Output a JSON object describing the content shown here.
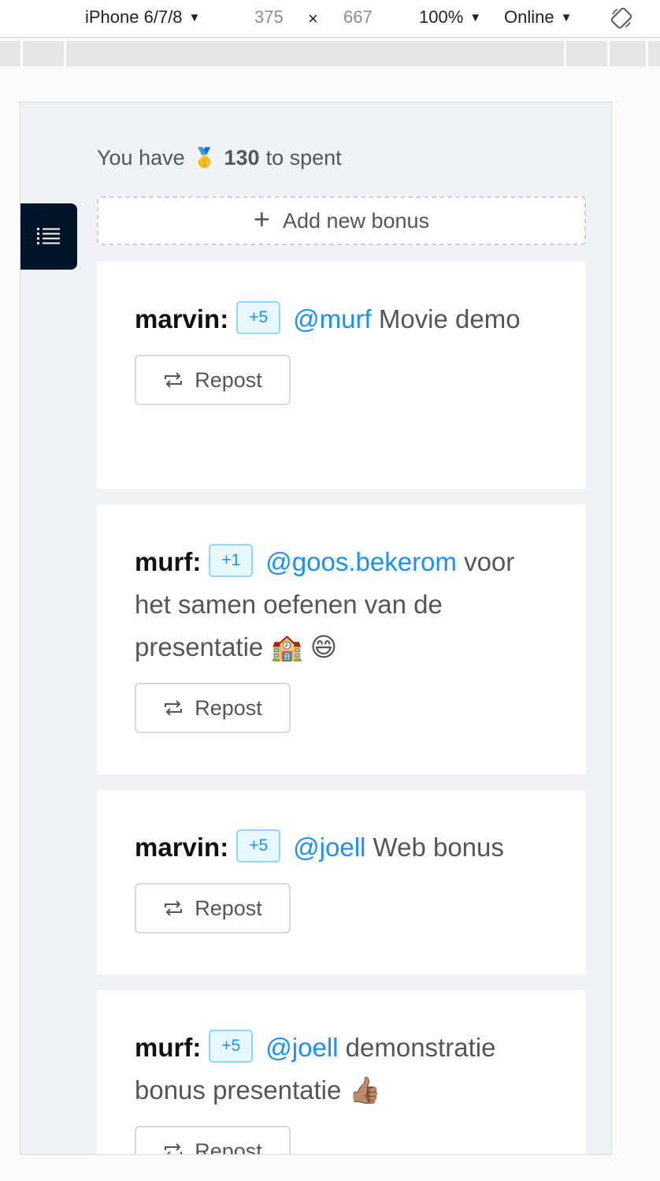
{
  "devtools": {
    "device": "iPhone 6/7/8",
    "width": "375",
    "times": "×",
    "height": "667",
    "zoom": "100%",
    "network": "Online",
    "caret": "▼"
  },
  "balance": {
    "prefix": "You have",
    "medal": "🥇",
    "amount": "130",
    "suffix": "to spent"
  },
  "add_bonus": {
    "icon": "+",
    "label": "Add new bonus"
  },
  "posts": [
    {
      "author": "marvin:",
      "points": "+5",
      "mention": "@murf",
      "text": " Movie demo",
      "repost": "Repost"
    },
    {
      "author": "murf:",
      "points": "+1",
      "mention": "@goos.bekerom",
      "text": " voor het samen oefenen van de presentatie 🏫  😄",
      "repost": "Repost"
    },
    {
      "author": "marvin:",
      "points": "+5",
      "mention": "@joell",
      "text": " Web bonus",
      "repost": "Repost"
    },
    {
      "author": "murf:",
      "points": "+5",
      "mention": "@joell",
      "text": " demonstratie bonus presentatie 👍🏽",
      "repost": "Repost"
    }
  ],
  "colors": {
    "sidebar_toggle": "#001529",
    "accent": "#1890ff",
    "badge_bg": "#e6f7ff",
    "page_bg": "#f0f2f5"
  },
  "icons": {
    "menu": "menu-list-icon",
    "add": "plus-icon",
    "repost": "repost-icon",
    "rotate": "rotate-icon"
  }
}
